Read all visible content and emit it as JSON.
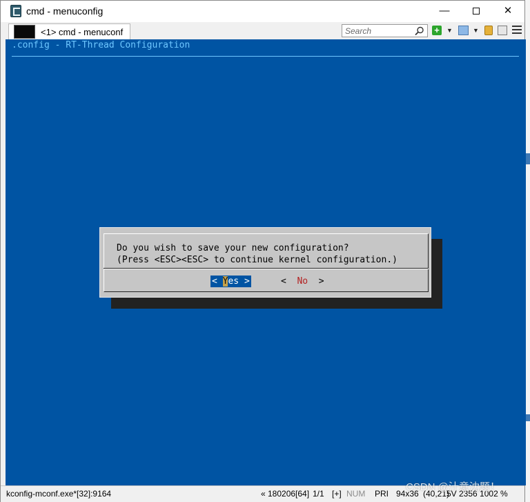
{
  "window": {
    "title": "cmd - menuconfig",
    "min_glyph": "—",
    "close_glyph": "✕"
  },
  "tab": {
    "label": "<1> cmd - menuconf"
  },
  "toolbar": {
    "search_placeholder": "Search",
    "plus_glyph": "+",
    "dropdown_glyph": "▼"
  },
  "console": {
    "header": ".config - RT-Thread Configuration",
    "dialog": {
      "line1": "Do you wish to save your new configuration?",
      "line2": "(Press <ESC><ESC> to continue kernel configuration.)",
      "yes_left": "< ",
      "yes_hot": "Y",
      "yes_rest": "es >",
      "no_left": "<  ",
      "no_hot": "No",
      "no_right": "  >"
    }
  },
  "statusbar": {
    "process": "kconfig-mconf.exe*[32]:9164",
    "position": "« 180206[64]",
    "page": "1/1",
    "insert": "[+]",
    "num": "NUM",
    "pri": "PRI",
    "size": "94x36",
    "cursor": "(40,21)",
    "pid_info": "5V 2356 1002",
    "zoom": "%"
  },
  "watermark": "CSDN @汁意沈题！",
  "colors": {
    "console_bg": "#0054a3",
    "header_text": "#6ec6ff",
    "dialog_bg": "#c6c6c6",
    "hotkey_no": "#b32020"
  },
  "icons": [
    "app-icon",
    "search-icon",
    "plus-icon",
    "dropdown-icon",
    "view-icon",
    "lock-icon",
    "panel-icon",
    "menu-icon"
  ]
}
